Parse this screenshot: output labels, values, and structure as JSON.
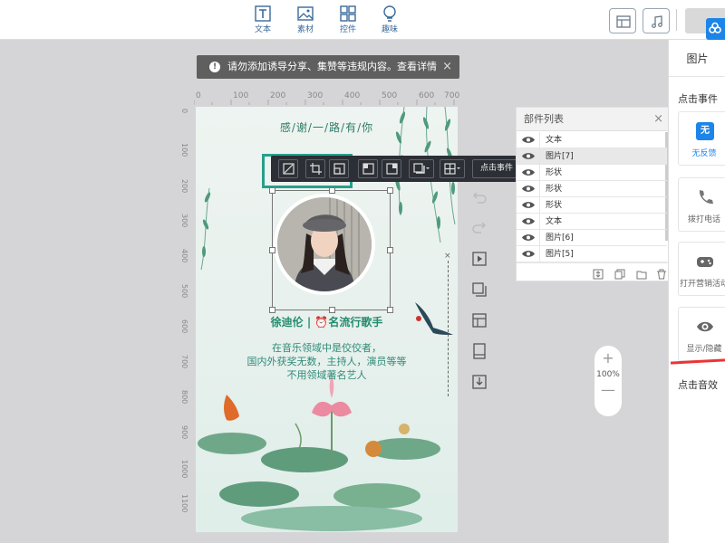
{
  "toolbar": {
    "tools": [
      {
        "label": "文本",
        "icon": "text-icon"
      },
      {
        "label": "素材",
        "icon": "image-icon"
      },
      {
        "label": "控件",
        "icon": "widget-icon"
      },
      {
        "label": "趣味",
        "icon": "bulb-icon"
      }
    ]
  },
  "notice": {
    "text": "请勿添加诱导分享、集赞等违规内容。查看详情",
    "close": "×"
  },
  "ruler": {
    "h_ticks": [
      "0",
      "100",
      "200",
      "300",
      "400",
      "500",
      "600",
      "700"
    ],
    "v_ticks": [
      "0",
      "100",
      "200",
      "300",
      "400",
      "500",
      "600",
      "700",
      "800",
      "900",
      "1000",
      "1100"
    ]
  },
  "canvas": {
    "thanks": "感/谢/一/路/有/你",
    "name_line": "徐迪伦  |  ⏰名流行歌手",
    "desc": [
      "在音乐领域中是佼佼者，",
      "国内外获奖无数，主持人，演员等等",
      "不用领域著名艺人"
    ]
  },
  "float_toolbar": {
    "event_select": "点击事件"
  },
  "layers": {
    "title": "部件列表",
    "close": "×",
    "items": [
      {
        "label": "文本",
        "selected": false
      },
      {
        "label": "图片[7]",
        "selected": true
      },
      {
        "label": "形状",
        "selected": false
      },
      {
        "label": "形状",
        "selected": false
      },
      {
        "label": "形状",
        "selected": false
      },
      {
        "label": "文本",
        "selected": false
      },
      {
        "label": "图片[6]",
        "selected": false
      },
      {
        "label": "图片[5]",
        "selected": false
      }
    ]
  },
  "zoom": {
    "plus": "+",
    "level": "100%",
    "minus": "—"
  },
  "right_panel": {
    "title": "图片",
    "section_event": "点击事件",
    "cards": [
      {
        "label": "无反馈",
        "icon": "no-feedback-icon"
      },
      {
        "label": "拨打电话",
        "icon": "phone-icon"
      },
      {
        "label": "打开营销活动",
        "icon": "gamepad-icon"
      },
      {
        "label": "显示/隐藏",
        "icon": "eye-icon"
      }
    ],
    "section_sound": "点击音效",
    "badge_text": "无"
  },
  "colors": {
    "accent": "#26a08a",
    "link": "#3a6a9a",
    "toolbar_bg": "#2c2f35",
    "blue_badge": "#1d84e8"
  }
}
